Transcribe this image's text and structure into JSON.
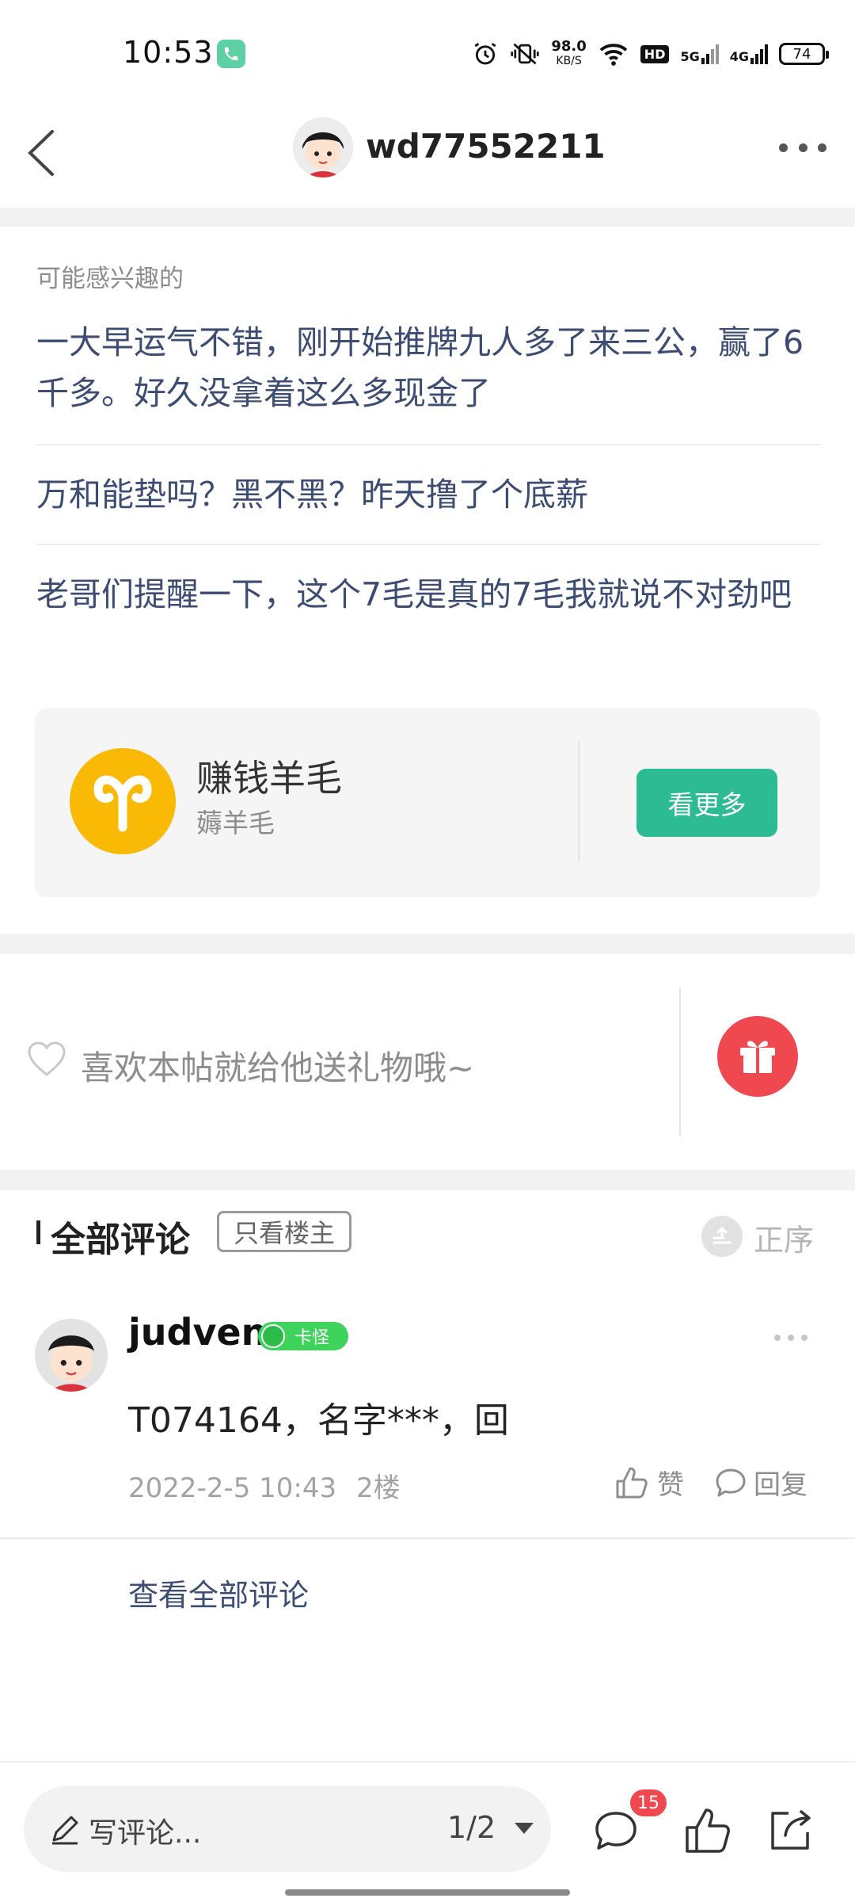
{
  "status_bar": {
    "time": "10:53",
    "speed_value": "98.0",
    "speed_unit": "KB/S",
    "net1": "5G",
    "net2": "4G",
    "hd": "HD",
    "battery": "74"
  },
  "header": {
    "username": "wd77552211"
  },
  "recommendations": {
    "title": "可能感兴趣的",
    "items": [
      "一大早运气不错，刚开始推牌九人多了来三公，赢了6千多。好久没拿着这么多现金了",
      "万和能垫吗？黑不黑？昨天撸了个底薪",
      "老哥们提醒一下，这个7毛是真的7毛我就说不对劲吧"
    ]
  },
  "group_card": {
    "name": "赚钱羊毛",
    "subtitle": "薅羊毛",
    "button": "看更多",
    "logo_color": "#f9b905"
  },
  "gift": {
    "text": "喜欢本帖就给他送礼物哦~"
  },
  "comments": {
    "title": "全部评论",
    "filter_label": "只看楼主",
    "order_label": "正序",
    "items": [
      {
        "username": "judven",
        "badge": "卡怪",
        "text": "T074164，名字***，回",
        "date": "2022-2-5 10:43",
        "floor": "2楼",
        "like_label": "赞",
        "reply_label": "回复"
      }
    ],
    "view_all": "查看全部评论"
  },
  "bottom_bar": {
    "comment_placeholder": "写评论...",
    "page": "1/2",
    "comment_count": "15"
  },
  "colors": {
    "accent_green": "#2dbb94",
    "link_blue": "#3c4c73",
    "gift_red": "#f0484f",
    "badge_green": "#3fd35c"
  }
}
